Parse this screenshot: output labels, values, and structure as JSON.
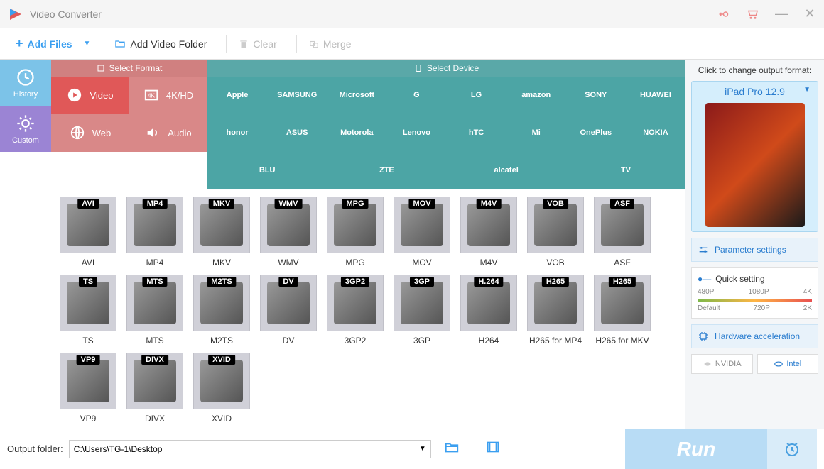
{
  "app": {
    "title": "Video Converter"
  },
  "toolbar": {
    "add_files": "Add Files",
    "add_folder": "Add Video Folder",
    "clear": "Clear",
    "merge": "Merge"
  },
  "leftcol": {
    "history": "History",
    "custom": "Custom"
  },
  "fmt_header": {
    "format": "Select Format",
    "device": "Select Device"
  },
  "categories": {
    "video": "Video",
    "hd": "4K/HD",
    "web": "Web",
    "audio": "Audio"
  },
  "devices_row1": [
    "Apple",
    "SAMSUNG",
    "Microsoft",
    "G",
    "LG",
    "amazon",
    "SONY",
    "HUAWEI",
    "honor",
    "ASUS"
  ],
  "devices_row2": [
    "Motorola",
    "Lenovo",
    "hTC",
    "Mi",
    "OnePlus",
    "NOKIA",
    "BLU",
    "ZTE",
    "alcatel",
    "TV"
  ],
  "formats": [
    {
      "badge": "AVI",
      "label": "AVI"
    },
    {
      "badge": "MP4",
      "label": "MP4"
    },
    {
      "badge": "MKV",
      "label": "MKV"
    },
    {
      "badge": "WMV",
      "label": "WMV"
    },
    {
      "badge": "MPG",
      "label": "MPG"
    },
    {
      "badge": "MOV",
      "label": "MOV"
    },
    {
      "badge": "M4V",
      "label": "M4V"
    },
    {
      "badge": "VOB",
      "label": "VOB"
    },
    {
      "badge": "ASF",
      "label": "ASF"
    },
    {
      "badge": "TS",
      "label": "TS"
    },
    {
      "badge": "MTS",
      "label": "MTS"
    },
    {
      "badge": "M2TS",
      "label": "M2TS"
    },
    {
      "badge": "DV",
      "label": "DV"
    },
    {
      "badge": "3GP2",
      "label": "3GP2"
    },
    {
      "badge": "3GP",
      "label": "3GP"
    },
    {
      "badge": "H.264",
      "label": "H264"
    },
    {
      "badge": "H265",
      "label": "H265 for MP4"
    },
    {
      "badge": "H265",
      "label": "H265 for MKV"
    },
    {
      "badge": "VP9",
      "label": "VP9"
    },
    {
      "badge": "DIVX",
      "label": "DIVX"
    },
    {
      "badge": "XVID",
      "label": "XVID"
    }
  ],
  "right": {
    "hint": "Click to change output format:",
    "preview_title": "iPad Pro 12.9",
    "param": "Parameter settings",
    "quick": "Quick setting",
    "ticks_top": [
      "480P",
      "1080P",
      "4K"
    ],
    "ticks_bot": [
      "Default",
      "720P",
      "2K"
    ],
    "hwaccel": "Hardware acceleration",
    "nvidia": "NVIDIA",
    "intel": "Intel"
  },
  "bottom": {
    "folder_label": "Output folder:",
    "folder_path": "C:\\Users\\TG-1\\Desktop",
    "run": "Run"
  }
}
